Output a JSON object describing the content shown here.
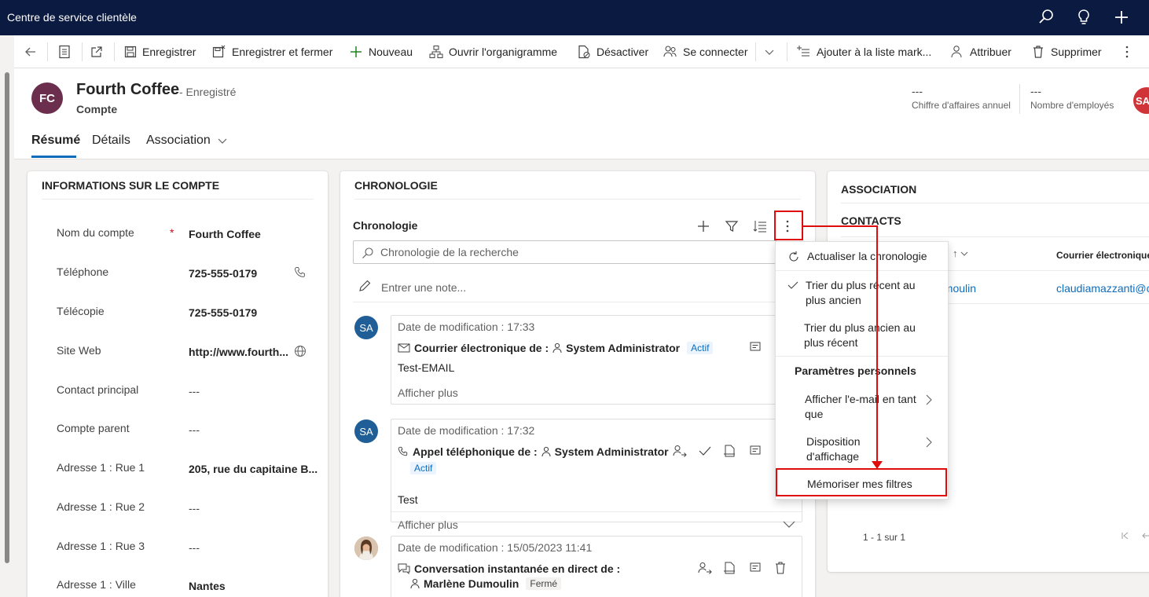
{
  "app": {
    "title": "Centre de service clientèle"
  },
  "commands": {
    "save": "Enregistrer",
    "save_close": "Enregistrer et fermer",
    "new": "Nouveau",
    "org_chart": "Ouvrir l'organigramme",
    "deactivate": "Désactiver",
    "connect": "Se connecter",
    "add_to_list": "Ajouter à la liste mark...",
    "assign": "Attribuer",
    "delete": "Supprimer"
  },
  "record": {
    "initials": "FC",
    "name": "Fourth Coffee",
    "status": "- Enregistré",
    "type": "Compte",
    "kpis": [
      {
        "value": "---",
        "label": "Chiffre d'affaires annuel"
      },
      {
        "value": "---",
        "label": "Nombre d'employés"
      }
    ],
    "owner_initials": "SA"
  },
  "tabs": [
    "Résumé",
    "Détails",
    "Association"
  ],
  "account_info": {
    "title": "INFORMATIONS SUR LE COMPTE",
    "required_mark": "*",
    "fields": [
      {
        "label": "Nom du compte",
        "value": "Fourth Coffee"
      },
      {
        "label": "Téléphone",
        "value": "725-555-0179"
      },
      {
        "label": "Télécopie",
        "value": "725-555-0179"
      },
      {
        "label": "Site Web",
        "value": "http://www.fourth..."
      },
      {
        "label": "Contact principal",
        "value": "---"
      },
      {
        "label": "Compte parent",
        "value": "---"
      },
      {
        "label": "Adresse 1 : Rue 1",
        "value": "205, rue du capitaine B..."
      },
      {
        "label": "Adresse 1 : Rue 2",
        "value": "---"
      },
      {
        "label": "Adresse 1 : Rue 3",
        "value": "---"
      },
      {
        "label": "Adresse 1 : Ville",
        "value": "Nantes"
      }
    ]
  },
  "timeline": {
    "section_title": "CHRONOLOGIE",
    "header": "Chronologie",
    "search_placeholder": "Chronologie de la recherche",
    "note_placeholder": "Entrer une note...",
    "entries": [
      {
        "avatar": "SA",
        "date": "Date de modification : 17:33",
        "title": "Courrier électronique de :",
        "who": "System Administrator",
        "badge": "Actif",
        "body": "Test-EMAIL",
        "more": "Afficher plus"
      },
      {
        "avatar": "SA",
        "date": "Date de modification : 17:32",
        "title": "Appel téléphonique de :",
        "who": "System Administrator",
        "badge": "Actif",
        "body": "Test",
        "more": "Afficher plus"
      },
      {
        "avatar": "",
        "date": "Date de modification : 15/05/2023 11:41",
        "title": "Conversation instantanée en direct de :",
        "who": "Marlène Dumoulin",
        "badge": "Fermé"
      }
    ]
  },
  "menu": {
    "refresh": "Actualiser la chronologie",
    "sort_newest": [
      "Trier du plus récent au",
      "plus ancien"
    ],
    "sort_oldest": [
      "Trier du plus ancien au",
      "plus récent"
    ],
    "personal_settings": "Paramètres personnels",
    "show_email": [
      "Afficher l'e-mail en tant",
      "que"
    ],
    "layout": [
      "Disposition",
      "d'affichage"
    ],
    "remember_filters": "Mémoriser mes filtres"
  },
  "association": {
    "title": "ASSOCIATION",
    "contacts_title": "CONTACTS",
    "sort_glyph": "↑",
    "col_email": "Courrier électronique",
    "row_name": "umoulin",
    "row_email": "claudiamazzanti@c",
    "pager": "1 - 1 sur 1"
  },
  "colors": {
    "topbar": "#0b1a40",
    "accent": "#0f6cbd",
    "callout": "#e00b0b",
    "avatar_fc": "#6b2f4d"
  }
}
